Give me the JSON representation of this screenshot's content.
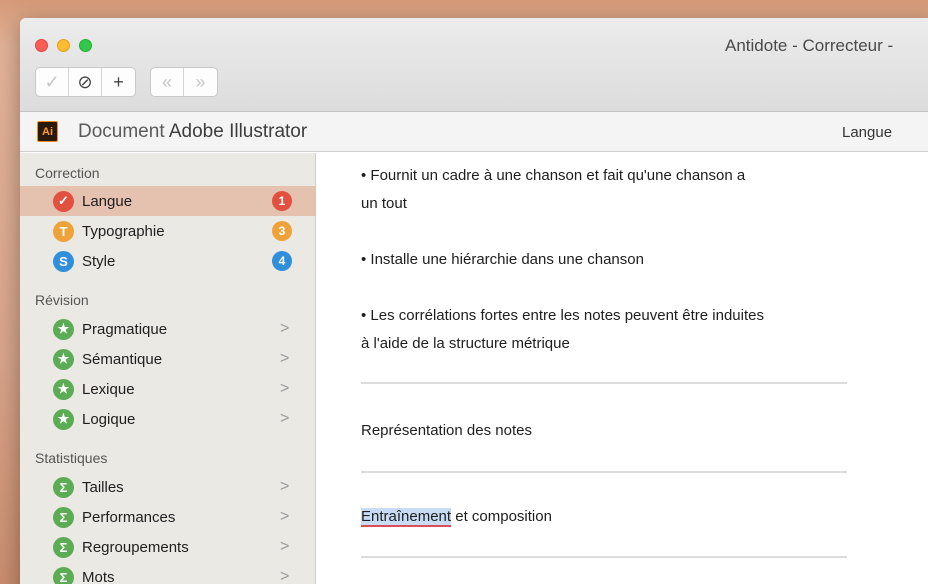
{
  "window": {
    "title": "Antidote - Correcteur -"
  },
  "toolbar": {
    "check": "✓",
    "ignore": "⊘",
    "add": "+",
    "prev": "«",
    "next": "»"
  },
  "document": {
    "app_icon": "Ai",
    "title_prefix": "Document",
    "title_app": "Adobe Illustrator",
    "panel_label": "Langue"
  },
  "sidebar": {
    "sections": [
      {
        "label": "Correction",
        "items": [
          {
            "label": "Langue",
            "icon": "✓",
            "icon_name": "check-icon",
            "icon_color": "#e2503f",
            "count": "1",
            "count_color": "#e2503f",
            "selected": true
          },
          {
            "label": "Typographie",
            "icon": "T",
            "icon_name": "typography-icon",
            "icon_color": "#f0a23a",
            "count": "3",
            "count_color": "#f0a23a"
          },
          {
            "label": "Style",
            "icon": "S",
            "icon_name": "style-icon",
            "icon_color": "#2f8fdb",
            "count": "4",
            "count_color": "#2f8fdb"
          }
        ]
      },
      {
        "label": "Révision",
        "items": [
          {
            "label": "Pragmatique",
            "icon": "★",
            "icon_name": "star-icon",
            "icon_color": "#5cab55",
            "chevron": ">"
          },
          {
            "label": "Sémantique",
            "icon": "★",
            "icon_name": "star-icon",
            "icon_color": "#5cab55",
            "chevron": ">"
          },
          {
            "label": "Lexique",
            "icon": "★",
            "icon_name": "star-icon",
            "icon_color": "#5cab55",
            "chevron": ">"
          },
          {
            "label": "Logique",
            "icon": "★",
            "icon_name": "star-icon",
            "icon_color": "#5cab55",
            "chevron": ">"
          }
        ]
      },
      {
        "label": "Statistiques",
        "items": [
          {
            "label": "Tailles",
            "icon": "Σ",
            "icon_name": "sigma-icon",
            "icon_color": "#5cab55",
            "chevron": ">"
          },
          {
            "label": "Performances",
            "icon": "Σ",
            "icon_name": "sigma-icon",
            "icon_color": "#5cab55",
            "chevron": ">"
          },
          {
            "label": "Regroupements",
            "icon": "Σ",
            "icon_name": "sigma-icon",
            "icon_color": "#5cab55",
            "chevron": ">"
          },
          {
            "label": "Mots",
            "icon": "Σ",
            "icon_name": "sigma-icon",
            "icon_color": "#5cab55",
            "chevron": ">"
          }
        ]
      }
    ]
  },
  "content": {
    "p1a": "• Fournit un cadre à une chanson et fait qu'une chanson a",
    "p1b": "un tout",
    "p2": "• Installe une hiérarchie dans une chanson",
    "p3a": "• Les corrélations fortes entre les notes peuvent être induites",
    "p3b": "à l'aide de la structure métrique",
    "h1": "Représentation des notes",
    "h2_error": "Entraînement",
    "h2_rest": " et composition"
  }
}
